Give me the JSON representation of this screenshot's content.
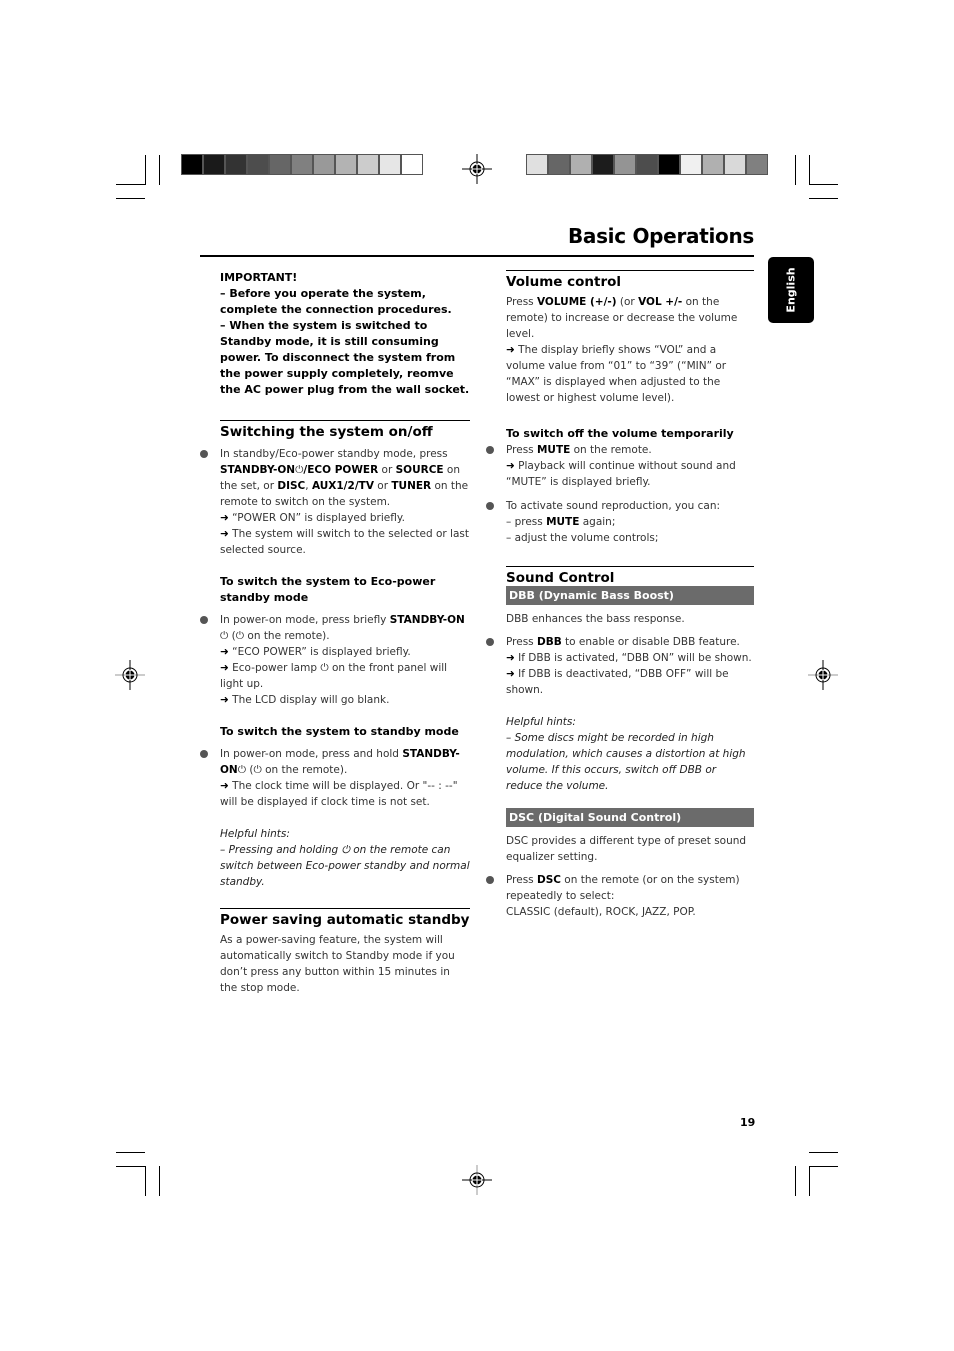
{
  "page": {
    "title": "Basic Operations",
    "language_tab": "English",
    "page_number": "19"
  },
  "colors": {
    "band_bg": "#6b6b6b",
    "bullet": "#555555",
    "left_bar": [
      "#000000",
      "#1a1a1a",
      "#333333",
      "#4d4d4d",
      "#666666",
      "#808080",
      "#999999",
      "#b3b3b3",
      "#cccccc",
      "#e6e6e6",
      "#ffffff"
    ],
    "right_bar": [
      "#e0e0e0",
      "#666666",
      "#b0b0b0",
      "#1c1c1c",
      "#949494",
      "#4d4d4d",
      "#000000",
      "#f0f0f0",
      "#b0b0b0",
      "#d9d9d9",
      "#808080"
    ]
  },
  "left": {
    "important": {
      "heading": "IMPORTANT!",
      "line1": "–  Before you operate the system, complete the connection procedures.",
      "line2": "–  When the system is switched to Standby mode,  it is still consuming power. To disconnect the system from the power supply completely, reomve the AC power plug from the wall socket."
    },
    "switching": {
      "heading": "Switching the system on/off",
      "b1_a": "In standby/Eco-power standby mode, press ",
      "b1_k1": "STANDBY-ON",
      "b1_k2": "/ECO POWER",
      "b1_b": " or ",
      "b1_k3": "SOURCE",
      "b1_c": " on the set, or ",
      "b1_k4": "DISC",
      "b1_d": ", ",
      "b1_k5": "AUX1/2/TV",
      "b1_e": " or ",
      "b1_k6": "TUNER",
      "b1_f": " on the remote to switch on the system.",
      "r1": " “POWER ON” is displayed briefly.",
      "r2": " The system will switch to the selected or last selected source."
    },
    "eco": {
      "heading": "To switch the system to Eco-power standby mode",
      "b_a": "In power-on mode, press briefly ",
      "b_k": "STANDBY-ON",
      "b_b": " on the remote).",
      "r1": " “ECO POWER” is displayed briefly.",
      "r2a": " Eco-power lamp ",
      "r2b": " on the front panel will light up.",
      "r3": " The LCD display will go blank."
    },
    "standby": {
      "heading": "To switch the system to standby mode",
      "b_a": "In power-on mode, press and hold ",
      "b_k": "STANDBY-ON",
      "b_b": " on the remote).",
      "r1": " The clock time will be displayed. Or \"-- : --\" will be displayed if clock time is not set.",
      "hint_label": "Helpful hints:",
      "hint_a": " –  Pressing and holding ",
      "hint_b": " on the remote can switch between Eco-power standby and normal standby."
    },
    "power_saving": {
      "heading": "Power saving automatic standby",
      "text": "As a power-saving feature, the system will automatically switch to Standby mode if you don’t press any button within 15 minutes in the stop mode."
    }
  },
  "right": {
    "volume": {
      "heading": "Volume control",
      "p_a": "Press ",
      "p_k1": "VOLUME (+/-)",
      "p_b": " (or ",
      "p_k2": "VOL +/-",
      "p_c": " on the remote) to increase or decrease the volume level.",
      "r1": " The display briefly shows “VOL” and a volume value from “01” to “39” (“MIN” or “MAX” is displayed when adjusted to the lowest or highest volume level)."
    },
    "mute": {
      "heading": "To switch off the volume temporarily",
      "b1_a": "Press ",
      "b1_k": "MUTE",
      "b1_b": " on the remote.",
      "r1": " Playback will continue without sound and “MUTE” is displayed briefly.",
      "b2": "To activate sound reproduction, you can:",
      "b2_l1a": "– press ",
      "b2_l1k": "MUTE",
      "b2_l1b": " again;",
      "b2_l2": "– adjust the volume controls;"
    },
    "sound": {
      "heading": "Sound Control",
      "dbb_band": "DBB (Dynamic Bass Boost)",
      "dbb_text": "DBB enhances the bass response.",
      "dbb_b_a": "Press ",
      "dbb_b_k": "DBB",
      "dbb_b_b": " to enable or disable DBB feature.",
      "dbb_r1": " If DBB is activated, “DBB ON” will be shown.",
      "dbb_r2": " If DBB is deactivated, “DBB OFF” will be shown.",
      "hint_label": "Helpful hints:",
      "hint_text": " –  Some discs might be recorded in high modulation, which causes a distortion at high volume. If this occurs, switch off DBB or reduce the volume.",
      "dsc_band": "DSC (Digital Sound Control)",
      "dsc_text": "DSC provides a different type of preset sound equalizer setting.",
      "dsc_b_a": "Press ",
      "dsc_b_k": "DSC",
      "dsc_b_b": " on the remote (or on the system) repeatedly to select:",
      "dsc_options": "CLASSIC (default), ROCK, JAZZ, POP."
    }
  },
  "icons": {
    "arrow": "➜",
    "power": "⏻"
  }
}
